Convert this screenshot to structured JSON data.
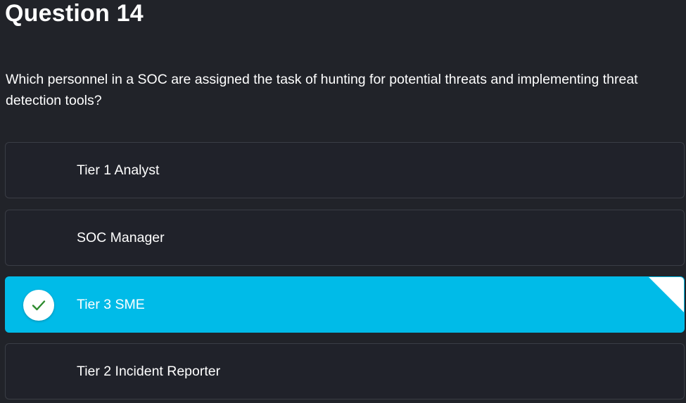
{
  "question": {
    "title": "Question 14",
    "text": "Which personnel in a SOC are assigned the task of hunting for potential threats and implementing threat detection tools?"
  },
  "options": [
    {
      "label": "Tier 1 Analyst",
      "selected": false
    },
    {
      "label": "SOC Manager",
      "selected": false
    },
    {
      "label": "Tier 3 SME",
      "selected": true
    },
    {
      "label": "Tier 2 Incident Reporter",
      "selected": false
    }
  ],
  "icons": {
    "selected_indicator": "checkmark-icon",
    "corner_marker": "corner-fold-icon"
  },
  "colors": {
    "background": "#212329",
    "option_background": "#20222a",
    "option_border": "#3a3d45",
    "selected_background": "#00bbe8",
    "checkmark": "#2e8b2e",
    "text": "#ffffff"
  }
}
